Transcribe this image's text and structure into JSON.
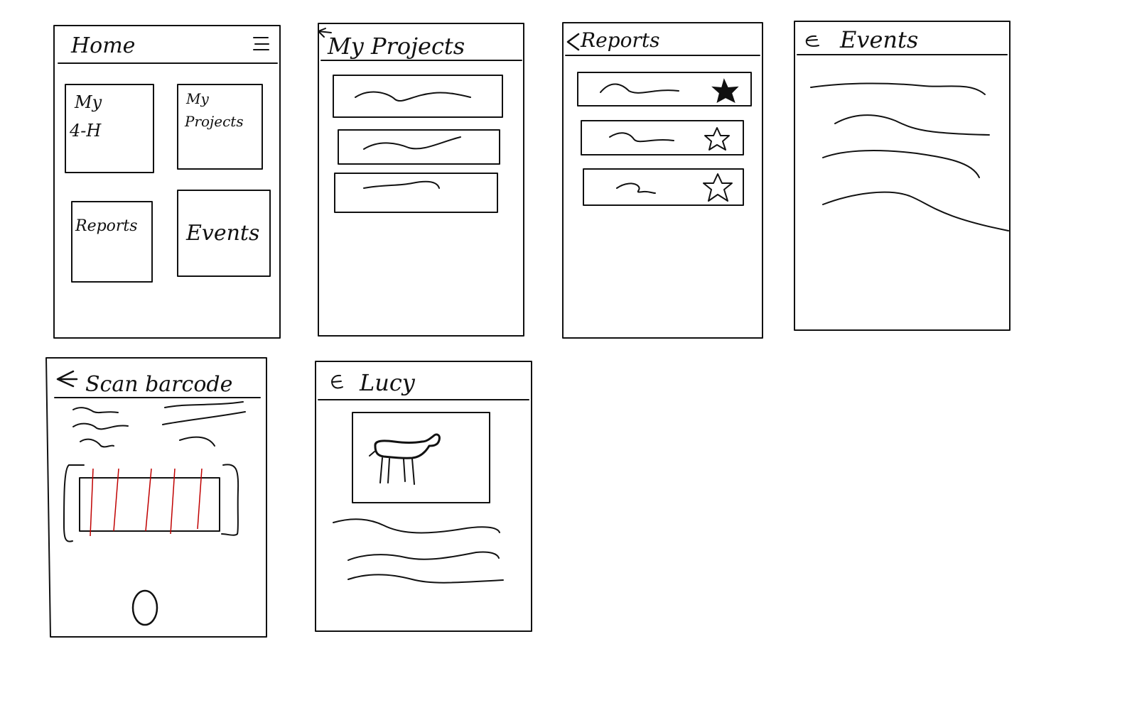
{
  "screens": {
    "home": {
      "title": "Home",
      "tiles": {
        "my4h_line1": "My",
        "my4h_line2": "4-H",
        "projects_line1": "My",
        "projects_line2": "Projects",
        "reports": "Reports",
        "events": "Events"
      }
    },
    "my_projects": {
      "title": "My Projects"
    },
    "reports": {
      "title": "Reports"
    },
    "events": {
      "title": "Events"
    },
    "scan_barcode": {
      "title": "Scan barcode"
    },
    "detail": {
      "title": "Lucy"
    }
  },
  "colors": {
    "ink": "#111111",
    "barcode_lines": "#c00000",
    "paper": "#ffffff"
  },
  "icons": [
    "hamburger-menu-icon",
    "back-arrow-icon",
    "star-icon",
    "star-filled-icon",
    "camera-shutter-icon",
    "animal-photo"
  ]
}
